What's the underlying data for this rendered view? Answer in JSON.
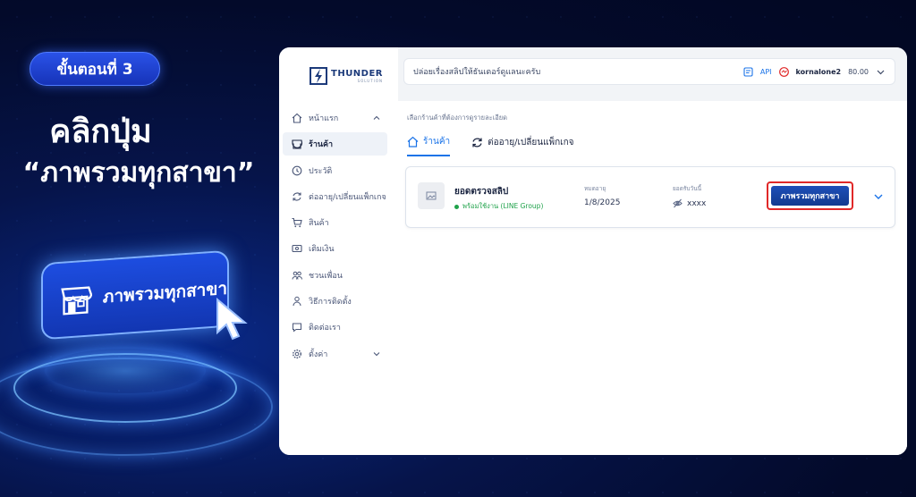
{
  "promo": {
    "step": "ขั้นตอนที่ 3",
    "headline1": "คลิกปุ่ม",
    "headline2": "“ภาพรวมทุกสาขา”",
    "button_label": "ภาพรวมทุกสาขา"
  },
  "app": {
    "logo_name": "THUNDER",
    "logo_sub": "SOLUTION",
    "sidebar": {
      "items": [
        {
          "label": "หน้าแรก",
          "icon": "home-icon"
        },
        {
          "label": "ร้านค้า",
          "icon": "store-icon"
        },
        {
          "label": "ประวัติ",
          "icon": "history-icon"
        },
        {
          "label": "ต่ออายุ/เปลี่ยนแพ็กเกจ",
          "icon": "renew-icon"
        },
        {
          "label": "สินค้า",
          "icon": "cart-icon"
        },
        {
          "label": "เติมเงิน",
          "icon": "topup-icon"
        },
        {
          "label": "ชวนเพื่อน",
          "icon": "invite-icon"
        },
        {
          "label": "วิธีการติดตั้ง",
          "icon": "install-icon"
        },
        {
          "label": "ติดต่อเรา",
          "icon": "contact-icon"
        },
        {
          "label": "ตั้งค่า",
          "icon": "gear-icon"
        }
      ]
    },
    "topbar": {
      "message": "ปล่อยเรื่องสลิปให้ธันเดอร์ดูแลนะครับ",
      "api_label": "API",
      "username": "kornalone2",
      "balance": "80.00"
    },
    "content": {
      "subtitle": "เลือกร้านค้าที่ต้องการดูรายละเอียด",
      "tabs": [
        {
          "label": "ร้านค้า",
          "active": true
        },
        {
          "label": "ต่ออายุ/เปลี่ยนแพ็กเกจ",
          "active": false
        }
      ],
      "card": {
        "shop_name": "ยอดตรวจสลิป",
        "status": "พร้อมใช้งาน (LINE Group)",
        "expiry_label": "หมดอายุ",
        "expiry_value": "1/8/2025",
        "today_label": "ยอดรับวันนี้",
        "today_value": "xxxx",
        "branch_button": "ภาพรวมทุกสาขา"
      }
    },
    "colors": {
      "accent": "#1a73e8",
      "status_green": "#1fa24a",
      "highlight_red": "#e02828",
      "button_blue": "#1e4fb8"
    }
  }
}
